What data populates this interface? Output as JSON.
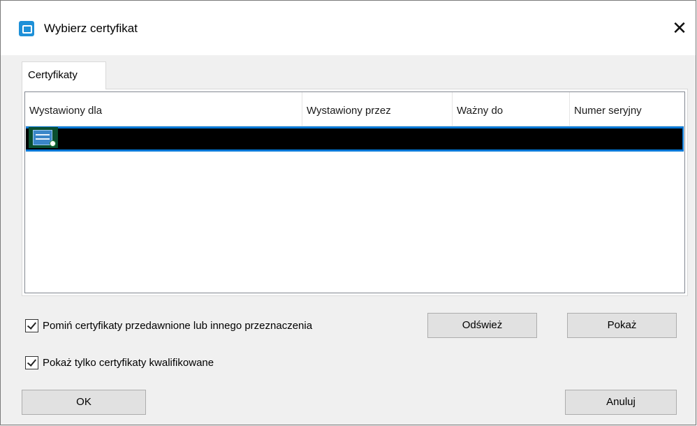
{
  "window": {
    "title": "Wybierz certyfikat",
    "close_glyph": "✕"
  },
  "tabs": [
    {
      "label": "Certyfikaty",
      "selected": true
    }
  ],
  "table": {
    "columns": [
      "Wystawiony dla",
      "Wystawiony przez",
      "Ważny do",
      "Numer seryjny"
    ],
    "rows": [
      {
        "icon": "certificate-icon",
        "issued_to": "",
        "issued_by": "",
        "valid_to": "",
        "serial": "",
        "selected": true,
        "redacted": true
      }
    ]
  },
  "options": {
    "skip_expired_label": "Pomiń certyfikaty przedawnione lub innego przeznaczenia",
    "skip_expired_checked": true,
    "qualified_only_label": "Pokaż tylko certyfikaty kwalifikowane",
    "qualified_only_checked": true
  },
  "buttons": {
    "refresh": "Odśwież",
    "show": "Pokaż",
    "ok": "OK",
    "cancel": "Anuluj"
  },
  "colors": {
    "selection": "#0078d7",
    "accent_icon": "#1e90d8"
  }
}
